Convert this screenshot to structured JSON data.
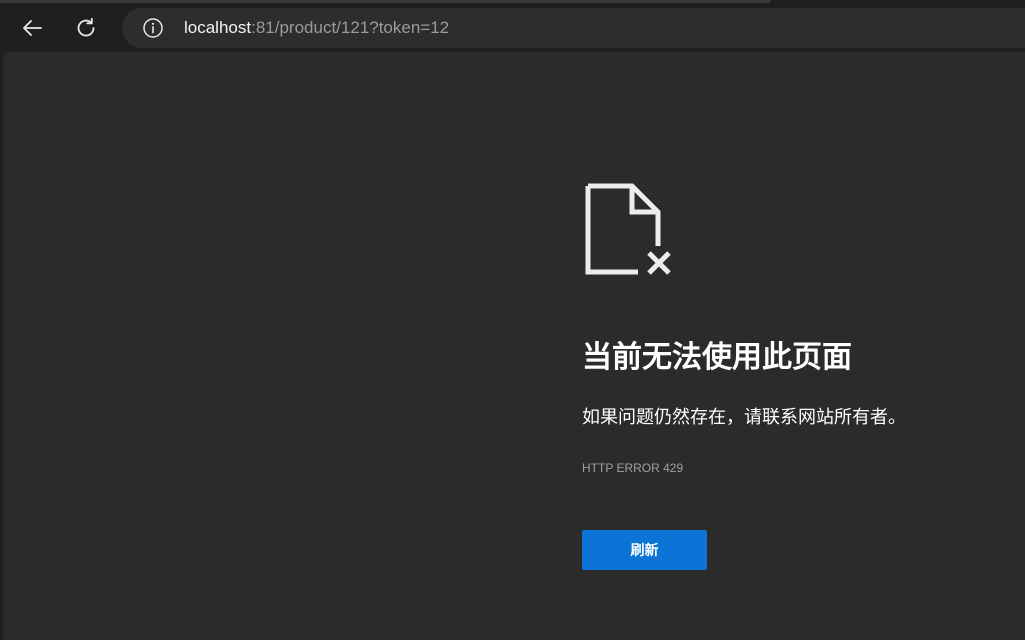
{
  "browser": {
    "url_host": "localhost",
    "url_rest": ":81/product/121?token=12",
    "icons": {
      "back": "back-arrow-icon",
      "reload": "reload-icon",
      "site_info": "info-icon"
    }
  },
  "error_page": {
    "icon": "broken-document-icon",
    "heading": "当前无法使用此页面",
    "message": "如果问题仍然存在，请联系网站所有者。",
    "error_code": "HTTP ERROR 429",
    "refresh_label": "刷新"
  },
  "colors": {
    "page_background": "#2b2b2b",
    "chrome_background": "#1f1f1f",
    "omnibox_background": "#2d2d2d",
    "button_accent": "#0b74d6"
  }
}
